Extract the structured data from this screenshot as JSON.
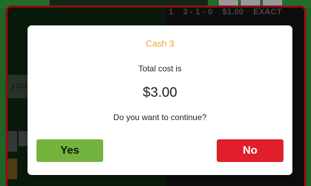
{
  "background": {
    "ticket_line": {
      "index": "1",
      "numbers": "3 - 1 - 0",
      "price": "$1.00",
      "play_type": "EXACT"
    },
    "side_label": "y COR"
  },
  "dialog": {
    "title": "Cash 3",
    "label": "Total cost is",
    "amount": "$3.00",
    "question": "Do you want to continue?",
    "yes_label": "Yes",
    "no_label": "No"
  },
  "colors": {
    "frame_border": "#e3141f",
    "title": "#f2a03a",
    "yes_button": "#72b43e",
    "no_button": "#e01f2a"
  }
}
